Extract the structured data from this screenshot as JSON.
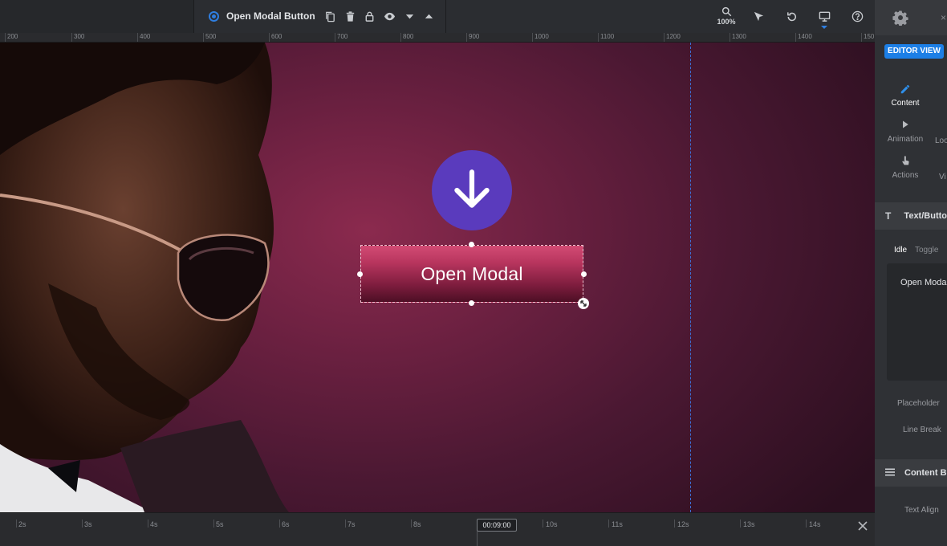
{
  "toolbar": {
    "layer_name": "Open Modal Button",
    "zoom_label": "100%",
    "icons": [
      "copy-icon",
      "trash-icon",
      "lock-icon",
      "eye-icon",
      "caret-down-icon",
      "caret-up-icon",
      "search-icon",
      "cursor-icon",
      "undo-icon",
      "monitor-icon",
      "help-icon"
    ]
  },
  "ruler": {
    "labels": [
      "200",
      "300",
      "400",
      "500",
      "600",
      "700",
      "800",
      "900",
      "1000",
      "1100",
      "1200",
      "1300",
      "1400",
      "150"
    ]
  },
  "canvas": {
    "button_label": "Open Modal",
    "accent_purple": "#5a3bbd",
    "button_pink": "#c93f69",
    "guide_blue": "#3f6ed4"
  },
  "timeline": {
    "labels": [
      "2s",
      "3s",
      "4s",
      "5s",
      "6s",
      "7s",
      "8s",
      "10s",
      "11s",
      "12s",
      "13s",
      "14s"
    ],
    "current_time": "00:09:00"
  },
  "panel": {
    "editor_view": "EDITOR VIEW",
    "tabs": {
      "content": "Content",
      "animation": "Animation",
      "actions": "Actions",
      "loop_fragment": "Loo",
      "vis_fragment": "Vi"
    },
    "section_text": "Text/Butto",
    "sub_tabs": {
      "idle": "Idle",
      "toggle": "Toggle"
    },
    "text_value": "Open Moda",
    "labels": {
      "placeholder": "Placeholder",
      "line_break": "Line Break",
      "text_align": "Text Align"
    },
    "section_content": "Content Bo",
    "accent_blue": "#1c7fe6"
  }
}
